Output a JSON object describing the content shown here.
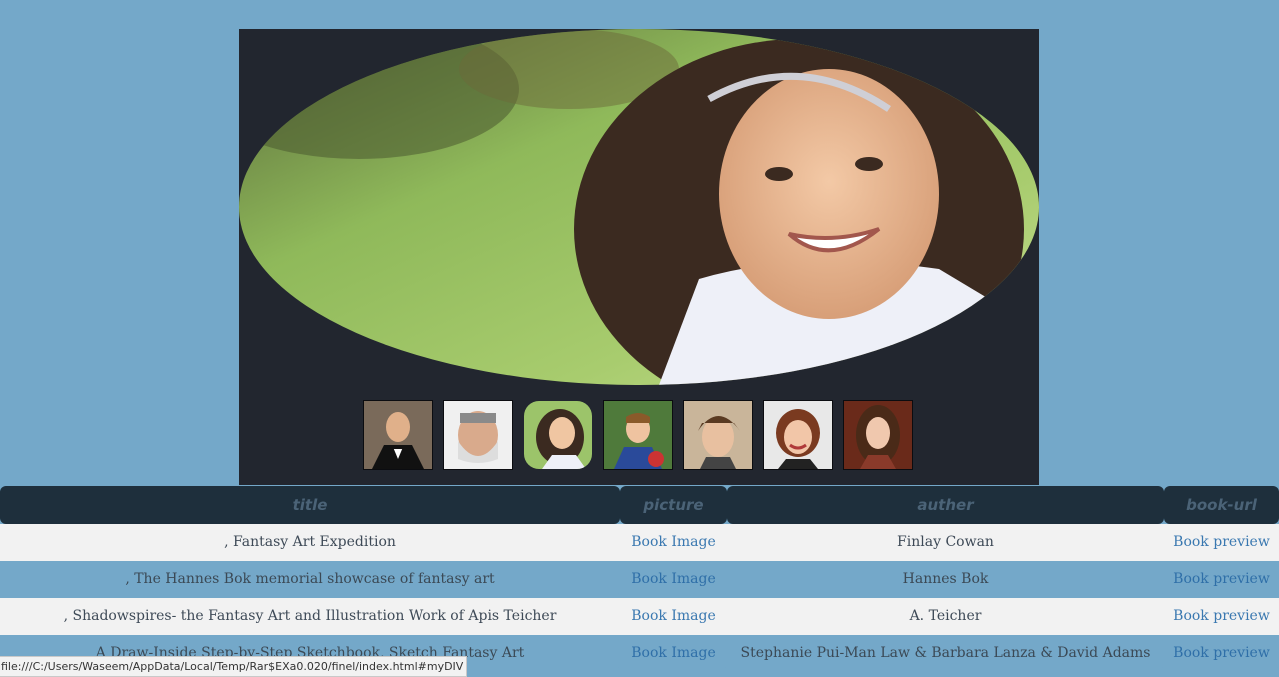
{
  "slider": {
    "main_photo_alt": "smiling girl with curly hair",
    "thumbnails": [
      {
        "name": "man in tuxedo",
        "active": false
      },
      {
        "name": "bearded old man",
        "active": false
      },
      {
        "name": "smiling girl",
        "active": true
      },
      {
        "name": "young boy",
        "active": false
      },
      {
        "name": "teen with fringe",
        "active": false
      },
      {
        "name": "red-haired woman",
        "active": false
      },
      {
        "name": "young woman",
        "active": false
      }
    ]
  },
  "table": {
    "headers": [
      "title",
      "picture",
      "auther",
      "book-url"
    ],
    "rows": [
      {
        "title": ", Fantasy Art Expedition",
        "picture": "Book Image",
        "author": "Finlay Cowan",
        "url": "Book preview"
      },
      {
        "title": ", The Hannes Bok memorial showcase of fantasy art",
        "picture": "Book Image",
        "author": "Hannes Bok",
        "url": "Book preview"
      },
      {
        "title": ", Shadowspires- the Fantasy Art and Illustration Work of Apis Teicher",
        "picture": "Book Image",
        "author": "A. Teicher",
        "url": "Book preview"
      },
      {
        "title": "A Draw-Inside Step-by-Step Sketchbook, Sketch Fantasy Art",
        "picture": "Book Image",
        "author": "Stephanie Pui-Man Law & Barbara Lanza & David Adams",
        "url": "Book preview"
      }
    ]
  },
  "status_bar": {
    "url": "file:///C:/Users/Waseem/AppData/Local/Temp/Rar$EXa0.020/finel/index.html#myDIV"
  }
}
